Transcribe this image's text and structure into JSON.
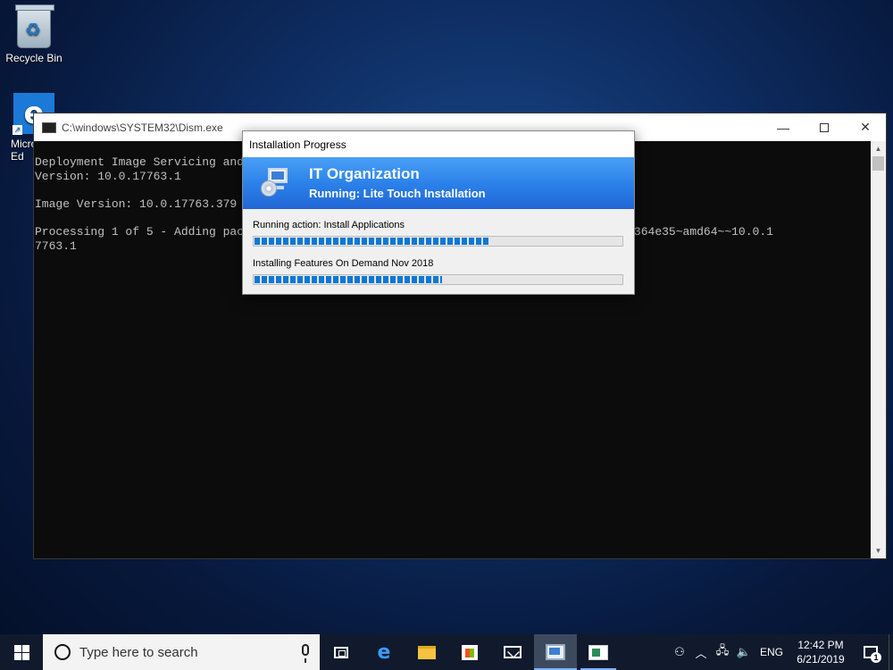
{
  "desktop": {
    "icons": [
      {
        "label": "Recycle Bin",
        "icon": "recycle-bin-icon"
      },
      {
        "label": "Micro\nEd",
        "icon": "edge-icon"
      }
    ]
  },
  "console": {
    "title": "C:\\windows\\SYSTEM32\\Dism.exe",
    "lines": [
      "Deployment Image Servicing and",
      "Version: 10.0.17763.1",
      "",
      "Image Version: 10.0.17763.379",
      "",
      "Processing 1 of 5 - Adding pac                                          age~31bf3856ad364e35~amd64~~10.0.1",
      "7763.1"
    ],
    "controls": {
      "minimize": "—",
      "close": "✕"
    }
  },
  "dialog": {
    "title": "Installation Progress",
    "organization": "IT Organization",
    "status": "Running: Lite Touch Installation",
    "progress": [
      {
        "label": "Running action: Install Applications",
        "fraction": 0.64
      },
      {
        "label": "Installing Features On Demand Nov 2018",
        "fraction": 0.51
      }
    ]
  },
  "taskbar": {
    "search_placeholder": "Type here to search",
    "language": "ENG",
    "time": "12:42 PM",
    "date": "6/21/2019",
    "notification_count": "1",
    "tray_icons": [
      "people-icon",
      "chevron-up-icon",
      "network-icon",
      "volume-icon"
    ]
  },
  "colors": {
    "accent": "#0b78d7",
    "banner_top": "#4aa0f5",
    "taskbar": "#101a2c"
  }
}
